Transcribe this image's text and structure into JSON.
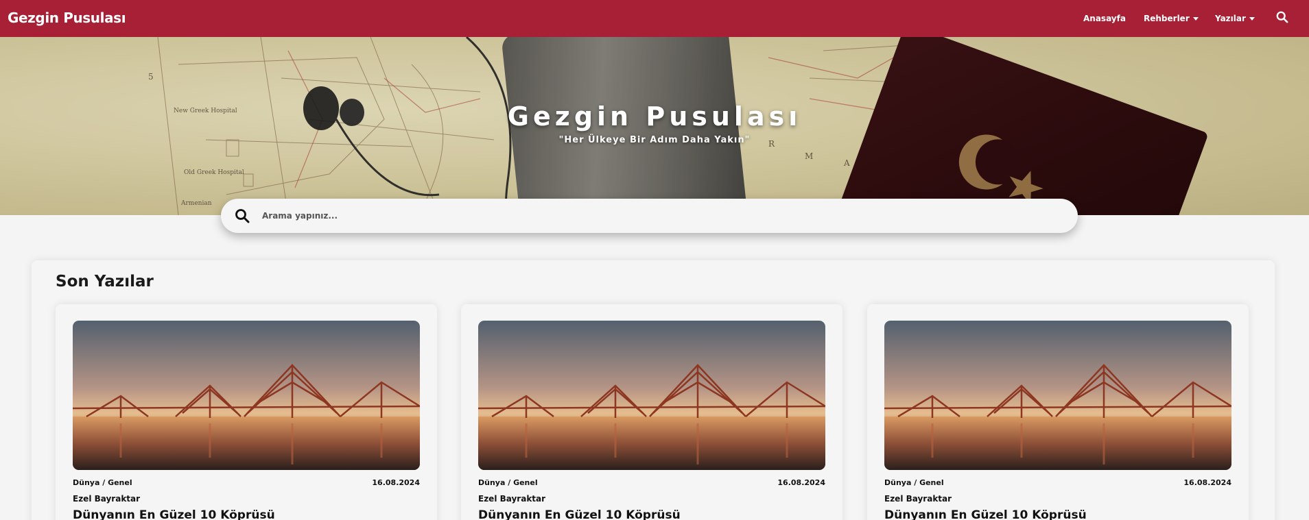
{
  "colors": {
    "brand": "#a82035",
    "background": "#f4f4f4",
    "card": "#f5f5f5"
  },
  "navbar": {
    "brand": "Gezgin Pusulası",
    "links": [
      {
        "label": "Anasayfa",
        "has_dropdown": false
      },
      {
        "label": "Rehberler",
        "has_dropdown": true,
        "icon": "chevron-down-icon"
      },
      {
        "label": "Yazılar",
        "has_dropdown": true,
        "icon": "chevron-down-icon"
      }
    ],
    "search_icon": "search-icon"
  },
  "hero": {
    "title": "Gezgin Pusulası",
    "subtitle": "\"Her Ülkeye Bir Adım Daha Yakın\""
  },
  "search": {
    "placeholder": "Arama yapınız...",
    "value": "",
    "icon": "search-icon"
  },
  "section": {
    "title": "Son Yazılar"
  },
  "posts": [
    {
      "category": "Dünya / Genel",
      "date": "16.08.2024",
      "author": "Ezel Bayraktar",
      "title": "Dünyanın En Güzel 10 Köprüsü"
    },
    {
      "category": "Dünya / Genel",
      "date": "16.08.2024",
      "author": "Ezel Bayraktar",
      "title": "Dünyanın En Güzel 10 Köprüsü"
    },
    {
      "category": "Dünya / Genel",
      "date": "16.08.2024",
      "author": "Ezel Bayraktar",
      "title": "Dünyanın En Güzel 10 Köprüsü"
    }
  ]
}
